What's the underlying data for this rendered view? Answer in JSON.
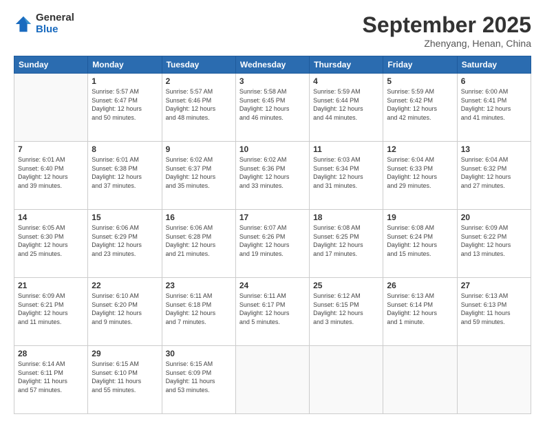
{
  "header": {
    "logo_general": "General",
    "logo_blue": "Blue",
    "month": "September 2025",
    "location": "Zhenyang, Henan, China"
  },
  "days_of_week": [
    "Sunday",
    "Monday",
    "Tuesday",
    "Wednesday",
    "Thursday",
    "Friday",
    "Saturday"
  ],
  "weeks": [
    [
      {
        "day": "",
        "info": ""
      },
      {
        "day": "1",
        "info": "Sunrise: 5:57 AM\nSunset: 6:47 PM\nDaylight: 12 hours\nand 50 minutes."
      },
      {
        "day": "2",
        "info": "Sunrise: 5:57 AM\nSunset: 6:46 PM\nDaylight: 12 hours\nand 48 minutes."
      },
      {
        "day": "3",
        "info": "Sunrise: 5:58 AM\nSunset: 6:45 PM\nDaylight: 12 hours\nand 46 minutes."
      },
      {
        "day": "4",
        "info": "Sunrise: 5:59 AM\nSunset: 6:44 PM\nDaylight: 12 hours\nand 44 minutes."
      },
      {
        "day": "5",
        "info": "Sunrise: 5:59 AM\nSunset: 6:42 PM\nDaylight: 12 hours\nand 42 minutes."
      },
      {
        "day": "6",
        "info": "Sunrise: 6:00 AM\nSunset: 6:41 PM\nDaylight: 12 hours\nand 41 minutes."
      }
    ],
    [
      {
        "day": "7",
        "info": "Sunrise: 6:01 AM\nSunset: 6:40 PM\nDaylight: 12 hours\nand 39 minutes."
      },
      {
        "day": "8",
        "info": "Sunrise: 6:01 AM\nSunset: 6:38 PM\nDaylight: 12 hours\nand 37 minutes."
      },
      {
        "day": "9",
        "info": "Sunrise: 6:02 AM\nSunset: 6:37 PM\nDaylight: 12 hours\nand 35 minutes."
      },
      {
        "day": "10",
        "info": "Sunrise: 6:02 AM\nSunset: 6:36 PM\nDaylight: 12 hours\nand 33 minutes."
      },
      {
        "day": "11",
        "info": "Sunrise: 6:03 AM\nSunset: 6:34 PM\nDaylight: 12 hours\nand 31 minutes."
      },
      {
        "day": "12",
        "info": "Sunrise: 6:04 AM\nSunset: 6:33 PM\nDaylight: 12 hours\nand 29 minutes."
      },
      {
        "day": "13",
        "info": "Sunrise: 6:04 AM\nSunset: 6:32 PM\nDaylight: 12 hours\nand 27 minutes."
      }
    ],
    [
      {
        "day": "14",
        "info": "Sunrise: 6:05 AM\nSunset: 6:30 PM\nDaylight: 12 hours\nand 25 minutes."
      },
      {
        "day": "15",
        "info": "Sunrise: 6:06 AM\nSunset: 6:29 PM\nDaylight: 12 hours\nand 23 minutes."
      },
      {
        "day": "16",
        "info": "Sunrise: 6:06 AM\nSunset: 6:28 PM\nDaylight: 12 hours\nand 21 minutes."
      },
      {
        "day": "17",
        "info": "Sunrise: 6:07 AM\nSunset: 6:26 PM\nDaylight: 12 hours\nand 19 minutes."
      },
      {
        "day": "18",
        "info": "Sunrise: 6:08 AM\nSunset: 6:25 PM\nDaylight: 12 hours\nand 17 minutes."
      },
      {
        "day": "19",
        "info": "Sunrise: 6:08 AM\nSunset: 6:24 PM\nDaylight: 12 hours\nand 15 minutes."
      },
      {
        "day": "20",
        "info": "Sunrise: 6:09 AM\nSunset: 6:22 PM\nDaylight: 12 hours\nand 13 minutes."
      }
    ],
    [
      {
        "day": "21",
        "info": "Sunrise: 6:09 AM\nSunset: 6:21 PM\nDaylight: 12 hours\nand 11 minutes."
      },
      {
        "day": "22",
        "info": "Sunrise: 6:10 AM\nSunset: 6:20 PM\nDaylight: 12 hours\nand 9 minutes."
      },
      {
        "day": "23",
        "info": "Sunrise: 6:11 AM\nSunset: 6:18 PM\nDaylight: 12 hours\nand 7 minutes."
      },
      {
        "day": "24",
        "info": "Sunrise: 6:11 AM\nSunset: 6:17 PM\nDaylight: 12 hours\nand 5 minutes."
      },
      {
        "day": "25",
        "info": "Sunrise: 6:12 AM\nSunset: 6:15 PM\nDaylight: 12 hours\nand 3 minutes."
      },
      {
        "day": "26",
        "info": "Sunrise: 6:13 AM\nSunset: 6:14 PM\nDaylight: 12 hours\nand 1 minute."
      },
      {
        "day": "27",
        "info": "Sunrise: 6:13 AM\nSunset: 6:13 PM\nDaylight: 11 hours\nand 59 minutes."
      }
    ],
    [
      {
        "day": "28",
        "info": "Sunrise: 6:14 AM\nSunset: 6:11 PM\nDaylight: 11 hours\nand 57 minutes."
      },
      {
        "day": "29",
        "info": "Sunrise: 6:15 AM\nSunset: 6:10 PM\nDaylight: 11 hours\nand 55 minutes."
      },
      {
        "day": "30",
        "info": "Sunrise: 6:15 AM\nSunset: 6:09 PM\nDaylight: 11 hours\nand 53 minutes."
      },
      {
        "day": "",
        "info": ""
      },
      {
        "day": "",
        "info": ""
      },
      {
        "day": "",
        "info": ""
      },
      {
        "day": "",
        "info": ""
      }
    ]
  ]
}
